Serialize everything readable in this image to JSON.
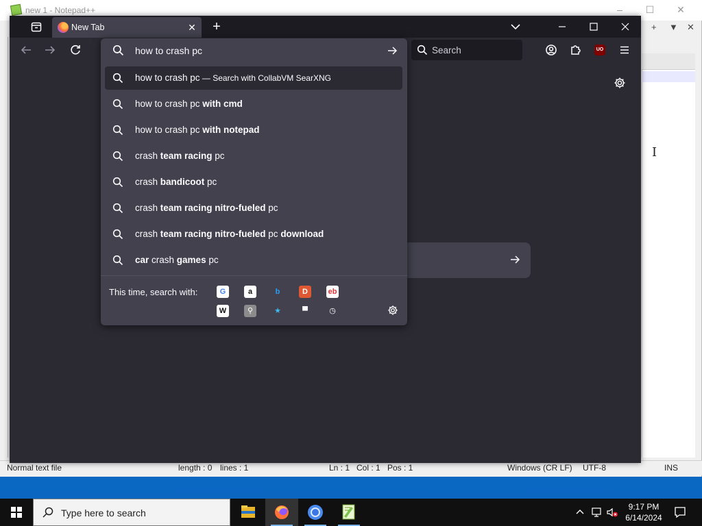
{
  "notepad": {
    "title": "new 1 - Notepad++",
    "right_menu": [
      "+",
      "▼",
      "✕"
    ],
    "status": {
      "file_type": "Normal text file",
      "length": "length : 0",
      "lines": "lines : 1",
      "ln": "Ln : 1",
      "col": "Col : 1",
      "pos": "Pos : 1",
      "eol": "Windows (CR LF)",
      "encoding": "UTF-8",
      "mode": "INS"
    }
  },
  "firefox": {
    "tab": {
      "title": "New Tab"
    },
    "search_placeholder": "Search",
    "ublock_label": "UO",
    "urlbar": {
      "value": "how to crash pc",
      "suggestions": [
        {
          "parts": [
            {
              "t": "how to crash pc",
              "b": false
            }
          ],
          "action": " — Search with CollabVM SearXNG",
          "selected": true
        },
        {
          "parts": [
            {
              "t": "how to crash pc ",
              "b": false
            },
            {
              "t": "with cmd",
              "b": true
            }
          ]
        },
        {
          "parts": [
            {
              "t": "how to crash pc ",
              "b": false
            },
            {
              "t": "with notepad",
              "b": true
            }
          ]
        },
        {
          "parts": [
            {
              "t": "crash ",
              "b": false
            },
            {
              "t": "team racing",
              "b": true
            },
            {
              "t": " pc",
              "b": false
            }
          ]
        },
        {
          "parts": [
            {
              "t": "crash ",
              "b": false
            },
            {
              "t": "bandicoot",
              "b": true
            },
            {
              "t": " pc",
              "b": false
            }
          ]
        },
        {
          "parts": [
            {
              "t": "crash ",
              "b": false
            },
            {
              "t": "team racing nitro-fueled",
              "b": true
            },
            {
              "t": " pc",
              "b": false
            }
          ]
        },
        {
          "parts": [
            {
              "t": "crash ",
              "b": false
            },
            {
              "t": "team racing nitro-fueled",
              "b": true
            },
            {
              "t": " pc ",
              "b": false
            },
            {
              "t": "download",
              "b": true
            }
          ]
        },
        {
          "parts": [
            {
              "t": "car",
              "b": true
            },
            {
              "t": " crash ",
              "b": false
            },
            {
              "t": "games",
              "b": true
            },
            {
              "t": " pc",
              "b": false
            }
          ]
        }
      ],
      "oneoff_label": "This time, search with:",
      "engines": [
        {
          "name": "google-engine-icon",
          "glyph": "G",
          "bg": "#ffffff",
          "fg": "#4285f4"
        },
        {
          "name": "amazon-engine-icon",
          "glyph": "a",
          "bg": "#ffffff",
          "fg": "#111111"
        },
        {
          "name": "bing-engine-icon",
          "glyph": "b",
          "bg": "transparent",
          "fg": "#2a9df4"
        },
        {
          "name": "duckduckgo-engine-icon",
          "glyph": "D",
          "bg": "#de5833",
          "fg": "#ffffff"
        },
        {
          "name": "ebay-engine-icon",
          "glyph": "eb",
          "bg": "#ffffff",
          "fg": "#e53238"
        },
        {
          "name": "wikipedia-engine-icon",
          "glyph": "W",
          "bg": "#ffffff",
          "fg": "#111111"
        },
        {
          "name": "searxng-engine-icon",
          "glyph": "⚲",
          "bg": "#8c8c8c",
          "fg": "#ffffff"
        },
        {
          "name": "bookmarks-engine-icon",
          "glyph": "★",
          "bg": "transparent",
          "fg": "#3fb9f0"
        },
        {
          "name": "tabs-engine-icon",
          "glyph": "▀",
          "bg": "transparent",
          "fg": "#fbfbfe"
        },
        {
          "name": "history-engine-icon",
          "glyph": "◷",
          "bg": "transparent",
          "fg": "#fbfbfe"
        }
      ]
    }
  },
  "taskbar": {
    "search_placeholder": "Type here to search",
    "clock_time": "9:17 PM",
    "clock_date": "6/14/2024"
  },
  "colors": {
    "ff_frame": "#1c1b22",
    "ff_toolbar": "#2b2a33",
    "ff_panel": "#42414d",
    "text": "#fbfbfe"
  }
}
